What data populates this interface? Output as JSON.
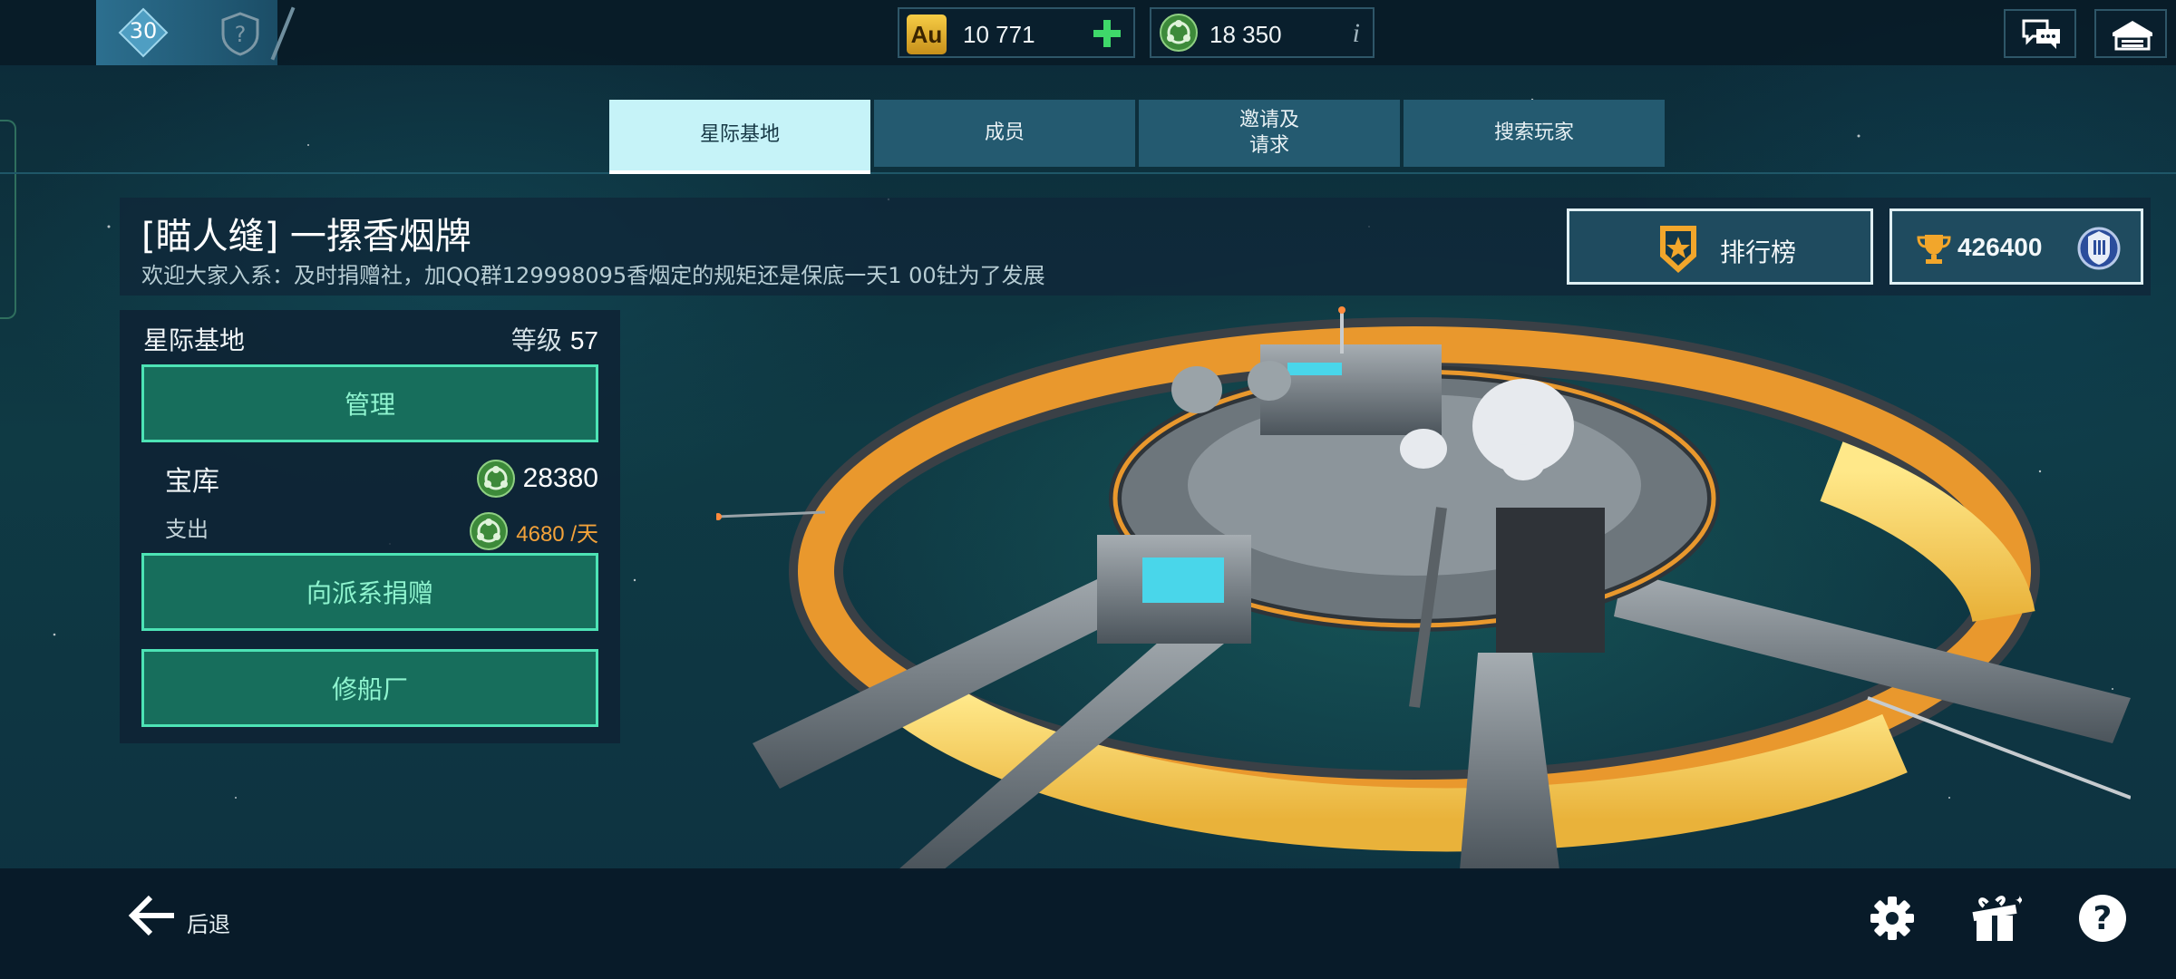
{
  "player": {
    "level": "30"
  },
  "currencies": {
    "gold": {
      "badge": "Au",
      "value": "10 771"
    },
    "credits": {
      "value": "18 350",
      "info": "i"
    }
  },
  "tabs": [
    {
      "label": "星际基地",
      "active": true
    },
    {
      "label": "成员",
      "active": false
    },
    {
      "label": "邀请及\n请求",
      "active": false
    },
    {
      "label": "搜索玩家",
      "active": false
    }
  ],
  "clan": {
    "name": "[瞄人缝] 一摞香烟牌",
    "description": "欢迎大家入系：及时捐赠社，加QQ群129998095香烟定的规矩还是保底一天1 00钍为了发展",
    "leaderboard_label": "排行榜",
    "score": "426400"
  },
  "base_panel": {
    "title": "星际基地",
    "level_label": "等级",
    "level_value": "57",
    "manage_label": "管理",
    "vault_label": "宝库",
    "vault_value": "28380",
    "spend_label": "支出",
    "spend_value": "4680 /天",
    "donate_label": "向派系捐赠",
    "shipyard_label": "修船厂"
  },
  "bottom": {
    "back_label": "后退"
  },
  "icons": {
    "chat": "chat-icon",
    "base": "hangar-icon",
    "settings": "gear-icon",
    "gift": "gift-icon",
    "help": "help-icon"
  },
  "colors": {
    "tab_active": "#c6f3f8",
    "tab_inactive": "#245a70",
    "button_fill": "#176e5c",
    "button_border": "#4de3b5",
    "spend": "#f3a23a",
    "gold": "#f6cc45"
  }
}
